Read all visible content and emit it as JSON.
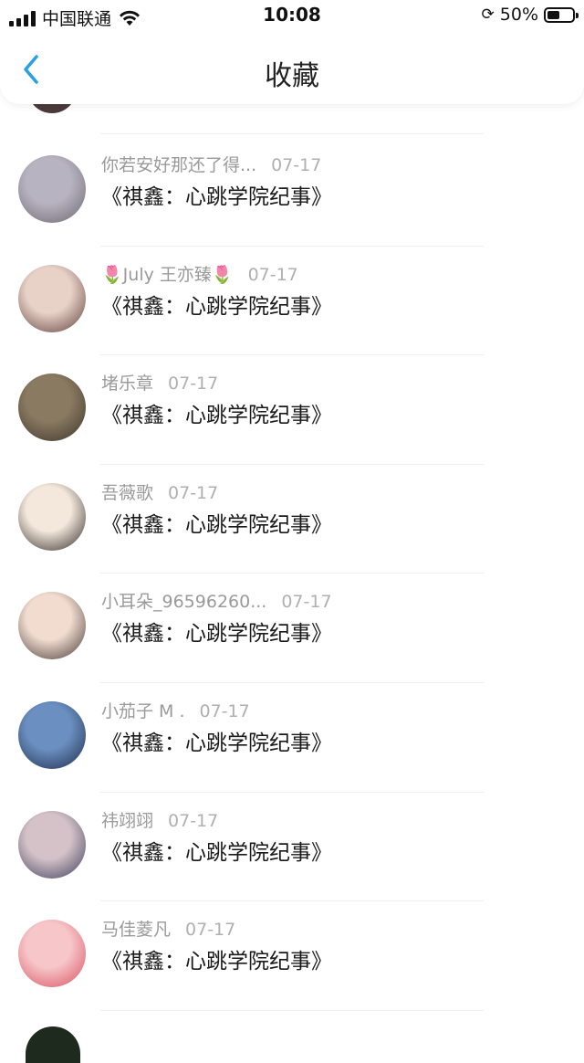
{
  "status": {
    "carrier": "中国联通",
    "time": "10:08",
    "battery_pct": "50%",
    "battery_level": 0.5
  },
  "nav": {
    "title": "收藏",
    "back_icon": "chevron-left-icon",
    "accent": "#2a9ee8"
  },
  "items": [
    {
      "user": "你若安好那还了得...",
      "date": "07-17",
      "work": "《祺鑫：心跳学院纪事》",
      "avatar_colors": [
        "#b8b3c0",
        "#6a6670"
      ]
    },
    {
      "user": "July 王亦臻",
      "user_prefix": "🌷",
      "user_suffix": "🌷",
      "date": "07-17",
      "work": "《祺鑫：心跳学院纪事》",
      "avatar_colors": [
        "#e8d2c8",
        "#5a3b35"
      ]
    },
    {
      "user": "堵乐章",
      "date": "07-17",
      "work": "《祺鑫：心跳学院纪事》",
      "avatar_colors": [
        "#8a7a62",
        "#3b3328"
      ]
    },
    {
      "user": "吾薇歌",
      "date": "07-17",
      "work": "《祺鑫：心跳学院纪事》",
      "avatar_colors": [
        "#f4e8dc",
        "#2b2522"
      ]
    },
    {
      "user": "小耳朵_96596260...",
      "date": "07-17",
      "work": "《祺鑫：心跳学院纪事》",
      "avatar_colors": [
        "#f2dcd0",
        "#40352f"
      ]
    },
    {
      "user": "小茄子 M .",
      "date": "07-17",
      "work": "《祺鑫：心跳学院纪事》",
      "avatar_colors": [
        "#6a8fc0",
        "#1d2a48"
      ]
    },
    {
      "user": "祎翊翊",
      "date": "07-17",
      "work": "《祺鑫：心跳学院纪事》",
      "avatar_colors": [
        "#d4c2c8",
        "#3a3a58"
      ]
    },
    {
      "user": "马佳菱凡",
      "date": "07-17",
      "work": "《祺鑫：心跳学院纪事》",
      "avatar_colors": [
        "#f6c6c8",
        "#d84c5c"
      ]
    }
  ]
}
